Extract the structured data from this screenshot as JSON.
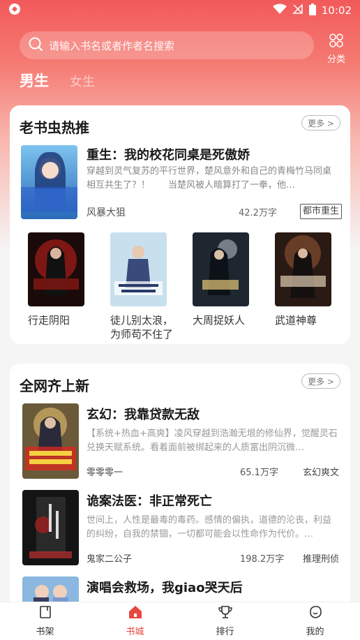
{
  "status": {
    "time": "10:02"
  },
  "search": {
    "placeholder": "请输入书名或者作者名搜索",
    "category_label": "分类"
  },
  "gender_tabs": {
    "male": "男生",
    "female": "女生"
  },
  "section1": {
    "title": "老书虫热推",
    "more": "更多 >",
    "featured": {
      "title": "重生：我的校花同桌是死傲娇",
      "desc": "穿越到灵气复苏的平行世界，楚风意外和自己的青梅竹马同桌相互共生了？！　　当楚风被人暗算打了一拳，他…",
      "author": "风暴大狙",
      "words": "42.2万字",
      "tag": "都市重生",
      "cover_text": "重生:我的校花同桌是死傲娇"
    },
    "grid": [
      {
        "name": "行走阴阳",
        "cover_text": "行走阴阳"
      },
      {
        "name": "徒儿别太浪，为师苟不住了",
        "cover_text": "徒儿别太浪为师苟不住了"
      },
      {
        "name": "大周捉妖人",
        "cover_text": "捉妖人"
      },
      {
        "name": "武道神尊",
        "cover_text": "武道神尊"
      }
    ]
  },
  "section2": {
    "title": "全网齐上新",
    "more": "更多 >",
    "items": [
      {
        "title": "玄幻：我靠贷款无敌",
        "desc": "【系统+热血+高爽】凌风穿越到浩瀚无垠的修仙界，觉醒灵石兑换天赋系统。看着面前被绑起来的人质富出阴沉微…",
        "author": "零零零一",
        "words": "65.1万字",
        "tag": "玄幻爽文",
        "cover_text": "玄幻我靠贷款无敌"
      },
      {
        "title": "诡案法医：非正常死亡",
        "desc": "世间上，人性是最毒的毒药。感情的偏执，道德的沦丧，利益的纠纷，自我的禁锢，一切都可能会以性命作为代价。…",
        "author": "鬼家二公子",
        "words": "198.2万字",
        "tag": "推理刑侦",
        "cover_text": "非正常死亡"
      },
      {
        "title": "演唱会救场，我giao哭天后",
        "desc": "",
        "author": "",
        "words": "",
        "tag": "",
        "cover_text": ""
      }
    ]
  },
  "nav": {
    "bookshelf": "书架",
    "bookstore": "书城",
    "ranking": "排行",
    "mine": "我的"
  },
  "colors": {
    "accent": "#e8473f",
    "header_top": "#f25a5a"
  }
}
